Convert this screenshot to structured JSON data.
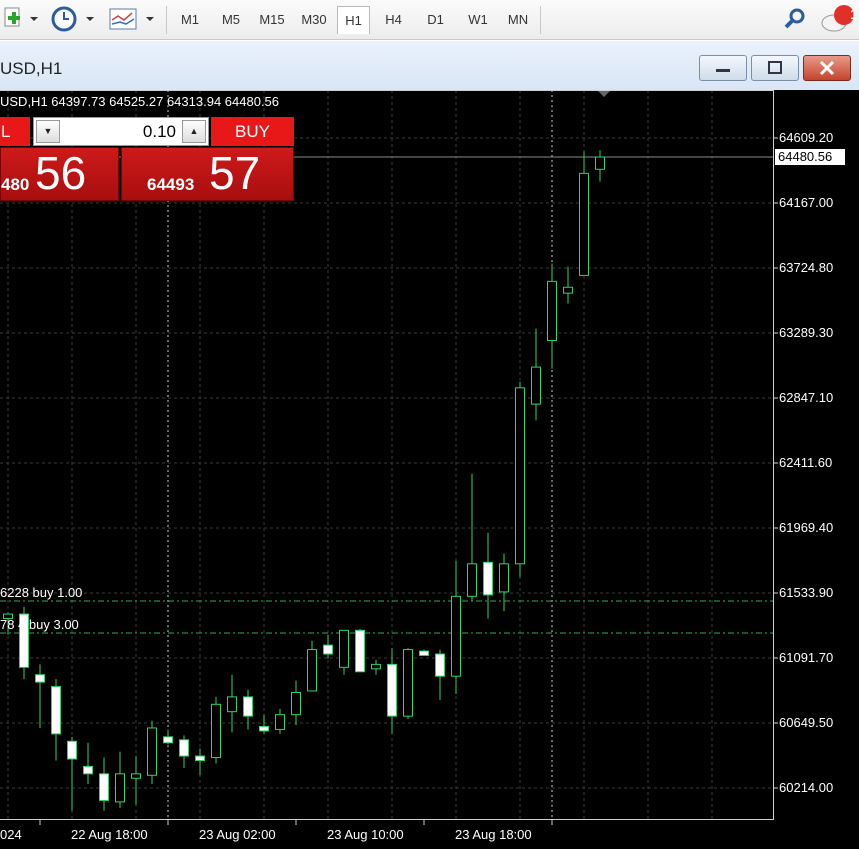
{
  "toolbar": {
    "timeframes": [
      "M1",
      "M5",
      "M15",
      "M30",
      "H1",
      "H4",
      "D1",
      "W1",
      "MN"
    ],
    "active_timeframe": "H1",
    "notification_count": "1"
  },
  "window": {
    "title": "USD,H1"
  },
  "chart": {
    "ohlc_header": "USD,H1  64397.73 64525.27 64313.94 64480.56",
    "current_price_label": "64480.56",
    "price_axis_labels": [
      "64609.20",
      "64167.00",
      "63724.80",
      "63289.30",
      "62847.10",
      "62411.60",
      "61969.40",
      "61533.90",
      "61091.70",
      "60649.50",
      "60214.00"
    ],
    "time_axis_labels": [
      "024",
      "22 Aug 18:00",
      "23 Aug 02:00",
      "23 Aug 10:00",
      "23 Aug 18:00"
    ],
    "order_lines": [
      {
        "label": "6228 buy 1.00"
      },
      {
        "label": "78 4 buy 3.00"
      }
    ]
  },
  "trade_panel": {
    "sell_label": "L",
    "buy_label": "BUY",
    "lot_value": "0.10",
    "sell_price_small": "480",
    "sell_price_big": "56",
    "buy_price_small": "64493",
    "buy_price_big": "57"
  },
  "chart_data": {
    "type": "candlestick",
    "price_range": [
      60000,
      64900
    ],
    "candles": [
      {
        "o": 61360,
        "h": 61400,
        "l": 61250,
        "c": 61390
      },
      {
        "o": 61390,
        "h": 61440,
        "l": 60950,
        "c": 61030
      },
      {
        "o": 60980,
        "h": 61050,
        "l": 60620,
        "c": 60930
      },
      {
        "o": 60900,
        "h": 60950,
        "l": 60400,
        "c": 60580
      },
      {
        "o": 60530,
        "h": 60560,
        "l": 60060,
        "c": 60410
      },
      {
        "o": 60360,
        "h": 60520,
        "l": 60240,
        "c": 60310
      },
      {
        "o": 60310,
        "h": 60420,
        "l": 60060,
        "c": 60130
      },
      {
        "o": 60120,
        "h": 60460,
        "l": 60080,
        "c": 60310
      },
      {
        "o": 60280,
        "h": 60430,
        "l": 60100,
        "c": 60310
      },
      {
        "o": 60300,
        "h": 60670,
        "l": 60240,
        "c": 60620
      },
      {
        "o": 60560,
        "h": 60610,
        "l": 60510,
        "c": 60520
      },
      {
        "o": 60540,
        "h": 60570,
        "l": 60350,
        "c": 60430
      },
      {
        "o": 60430,
        "h": 60480,
        "l": 60300,
        "c": 60400
      },
      {
        "o": 60420,
        "h": 60830,
        "l": 60380,
        "c": 60780
      },
      {
        "o": 60730,
        "h": 60980,
        "l": 60590,
        "c": 60830
      },
      {
        "o": 60830,
        "h": 60880,
        "l": 60610,
        "c": 60700
      },
      {
        "o": 60630,
        "h": 60710,
        "l": 60580,
        "c": 60600
      },
      {
        "o": 60610,
        "h": 60750,
        "l": 60580,
        "c": 60710
      },
      {
        "o": 60710,
        "h": 60940,
        "l": 60640,
        "c": 60860
      },
      {
        "o": 60870,
        "h": 61210,
        "l": 60870,
        "c": 61150
      },
      {
        "o": 61180,
        "h": 61250,
        "l": 61090,
        "c": 61120
      },
      {
        "o": 61030,
        "h": 61280,
        "l": 60980,
        "c": 61280
      },
      {
        "o": 61280,
        "h": 61290,
        "l": 61000,
        "c": 61000
      },
      {
        "o": 61020,
        "h": 61080,
        "l": 60980,
        "c": 61050
      },
      {
        "o": 61050,
        "h": 61160,
        "l": 60580,
        "c": 60700
      },
      {
        "o": 60700,
        "h": 61160,
        "l": 60680,
        "c": 61150
      },
      {
        "o": 61140,
        "h": 61150,
        "l": 61110,
        "c": 61110
      },
      {
        "o": 61120,
        "h": 61150,
        "l": 60810,
        "c": 60970
      },
      {
        "o": 60970,
        "h": 61750,
        "l": 60850,
        "c": 61510
      },
      {
        "o": 61510,
        "h": 62340,
        "l": 61480,
        "c": 61730
      },
      {
        "o": 61740,
        "h": 61940,
        "l": 61360,
        "c": 61520
      },
      {
        "o": 61540,
        "h": 61800,
        "l": 61410,
        "c": 61730
      },
      {
        "o": 61730,
        "h": 62960,
        "l": 61640,
        "c": 62920
      },
      {
        "o": 62810,
        "h": 63320,
        "l": 62700,
        "c": 63060
      },
      {
        "o": 63240,
        "h": 63760,
        "l": 63050,
        "c": 63640
      },
      {
        "o": 63560,
        "h": 63740,
        "l": 63490,
        "c": 63600
      },
      {
        "o": 63680,
        "h": 64520,
        "l": 63680,
        "c": 64370
      },
      {
        "o": 64397.73,
        "h": 64525.27,
        "l": 64313.94,
        "c": 64480.56
      }
    ]
  }
}
